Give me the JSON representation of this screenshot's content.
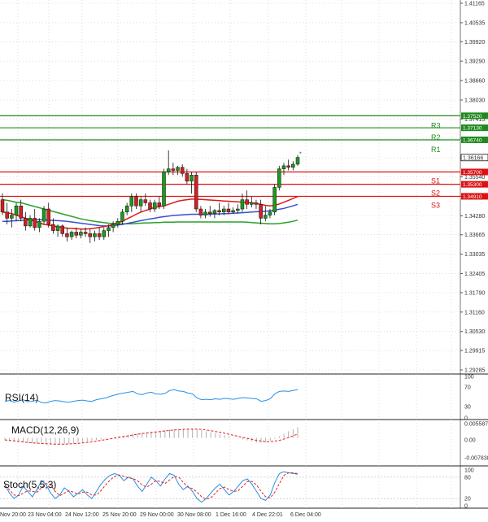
{
  "chart_data": {
    "type": "candlestick",
    "price_axis_ticks": [
      "1.41165",
      "1.40535",
      "1.39920",
      "1.39290",
      "1.38660",
      "1.38030",
      "1.37415",
      "1.36785",
      "1.36155",
      "1.35540",
      "1.34910",
      "1.34280",
      "1.33665",
      "1.33035",
      "1.32405",
      "1.31790",
      "1.31160",
      "1.30530",
      "1.29915",
      "1.29285"
    ],
    "time_axis_labels": [
      "Nov 20:00",
      "23 Nov 04:00",
      "24 Nov 12:00",
      "25 Nov 20:00",
      "29 Nov 00:00",
      "30 Nov 08:00",
      "1 Dec 16:00",
      "4 Dec 22:01",
      "6 Dec 04:00"
    ],
    "current_price": "1.36166",
    "levels": [
      {
        "name": "R3",
        "value": "1.37520",
        "color": "#1e8a1e"
      },
      {
        "name": "R2",
        "value": "1.37130",
        "color": "#1e8a1e"
      },
      {
        "name": "R1",
        "value": "1.36740",
        "color": "#1e8a1e"
      },
      {
        "name": "S1",
        "value": "1.35700",
        "color": "#dd1111"
      },
      {
        "name": "S2",
        "value": "1.35300",
        "color": "#dd1111"
      },
      {
        "name": "S3",
        "value": "1.34910",
        "color": "#dd1111"
      }
    ],
    "candles": [
      [
        1.348,
        1.35,
        1.343,
        1.344
      ],
      [
        1.344,
        1.347,
        1.34,
        1.342
      ],
      [
        1.342,
        1.345,
        1.339,
        1.343
      ],
      [
        1.343,
        1.347,
        1.341,
        1.346
      ],
      [
        1.346,
        1.348,
        1.341,
        1.342
      ],
      [
        1.342,
        1.344,
        1.338,
        1.3395
      ],
      [
        1.3395,
        1.343,
        1.339,
        1.342
      ],
      [
        1.342,
        1.345,
        1.338,
        1.339
      ],
      [
        1.339,
        1.342,
        1.3375,
        1.341
      ],
      [
        1.341,
        1.346,
        1.34,
        1.345
      ],
      [
        1.345,
        1.347,
        1.339,
        1.34
      ],
      [
        1.34,
        1.342,
        1.337,
        1.338
      ],
      [
        1.338,
        1.34,
        1.336,
        1.3395
      ],
      [
        1.3395,
        1.34,
        1.336,
        1.337
      ],
      [
        1.337,
        1.339,
        1.3345,
        1.336
      ],
      [
        1.336,
        1.338,
        1.335,
        1.3375
      ],
      [
        1.3375,
        1.339,
        1.3355,
        1.3365
      ],
      [
        1.3365,
        1.3385,
        1.3355,
        1.3375
      ],
      [
        1.3375,
        1.339,
        1.336,
        1.337
      ],
      [
        1.337,
        1.3385,
        1.334,
        1.336
      ],
      [
        1.336,
        1.338,
        1.3345,
        1.337
      ],
      [
        1.337,
        1.339,
        1.335,
        1.336
      ],
      [
        1.336,
        1.339,
        1.335,
        1.338
      ],
      [
        1.338,
        1.34,
        1.336,
        1.339
      ],
      [
        1.339,
        1.341,
        1.3375,
        1.34
      ],
      [
        1.34,
        1.342,
        1.339,
        1.341
      ],
      [
        1.341,
        1.345,
        1.34,
        1.344
      ],
      [
        1.344,
        1.347,
        1.343,
        1.346
      ],
      [
        1.346,
        1.35,
        1.344,
        1.349
      ],
      [
        1.349,
        1.35,
        1.345,
        1.346
      ],
      [
        1.346,
        1.349,
        1.344,
        1.348
      ],
      [
        1.348,
        1.35,
        1.346,
        1.347
      ],
      [
        1.347,
        1.348,
        1.344,
        1.345
      ],
      [
        1.345,
        1.348,
        1.344,
        1.347
      ],
      [
        1.347,
        1.349,
        1.345,
        1.346
      ],
      [
        1.346,
        1.358,
        1.345,
        1.357
      ],
      [
        1.357,
        1.364,
        1.356,
        1.358
      ],
      [
        1.358,
        1.36,
        1.356,
        1.3575
      ],
      [
        1.3575,
        1.359,
        1.356,
        1.3585
      ],
      [
        1.3585,
        1.3595,
        1.3555,
        1.3565
      ],
      [
        1.3565,
        1.358,
        1.353,
        1.354
      ],
      [
        1.354,
        1.357,
        1.35,
        1.356
      ],
      [
        1.356,
        1.357,
        1.344,
        1.345
      ],
      [
        1.345,
        1.346,
        1.342,
        1.343
      ],
      [
        1.343,
        1.345,
        1.342,
        1.344
      ],
      [
        1.344,
        1.346,
        1.3425,
        1.3435
      ],
      [
        1.3435,
        1.345,
        1.342,
        1.3445
      ],
      [
        1.3445,
        1.347,
        1.343,
        1.344
      ],
      [
        1.344,
        1.346,
        1.343,
        1.345
      ],
      [
        1.345,
        1.347,
        1.3435,
        1.344
      ],
      [
        1.344,
        1.3455,
        1.3435,
        1.3445
      ],
      [
        1.3445,
        1.3465,
        1.3435,
        1.345
      ],
      [
        1.345,
        1.35,
        1.344,
        1.348
      ],
      [
        1.348,
        1.351,
        1.345,
        1.3465
      ],
      [
        1.3465,
        1.349,
        1.3455,
        1.347
      ],
      [
        1.347,
        1.348,
        1.345,
        1.3465
      ],
      [
        1.3465,
        1.348,
        1.34,
        1.342
      ],
      [
        1.342,
        1.346,
        1.341,
        1.343
      ],
      [
        1.343,
        1.345,
        1.342,
        1.344
      ],
      [
        1.344,
        1.353,
        1.343,
        1.352
      ],
      [
        1.352,
        1.359,
        1.351,
        1.358
      ],
      [
        1.358,
        1.36,
        1.356,
        1.359
      ],
      [
        1.359,
        1.361,
        1.3575,
        1.3585
      ],
      [
        1.3585,
        1.3605,
        1.3575,
        1.3595
      ],
      [
        1.3595,
        1.3625,
        1.359,
        1.3617
      ]
    ],
    "ma_red": [
      1.344,
      1.3438,
      1.3435,
      1.343,
      1.3425,
      1.342,
      1.3415,
      1.341,
      1.3405,
      1.34,
      1.3398,
      1.3395,
      1.3392,
      1.339,
      1.3388,
      1.3387,
      1.3386,
      1.3385,
      1.3385,
      1.3386,
      1.3388,
      1.339,
      1.3393,
      1.3396,
      1.34,
      1.3405,
      1.341,
      1.3418,
      1.3425,
      1.3433,
      1.344,
      1.3445,
      1.345,
      1.3455,
      1.3458,
      1.346,
      1.3465,
      1.347,
      1.3475,
      1.3478,
      1.348,
      1.3482,
      1.3482,
      1.3481,
      1.348,
      1.3479,
      1.3478,
      1.3477,
      1.3476,
      1.3475,
      1.3474,
      1.3473,
      1.3472,
      1.3471,
      1.347,
      1.3468,
      1.3465,
      1.3462,
      1.346,
      1.3462,
      1.3466,
      1.3472,
      1.3478,
      1.3484,
      1.349
    ],
    "ma_blue": [
      1.341,
      1.341,
      1.3411,
      1.3412,
      1.3413,
      1.3414,
      1.3415,
      1.3415,
      1.3415,
      1.3415,
      1.3414,
      1.3413,
      1.3412,
      1.3411,
      1.341,
      1.3408,
      1.3406,
      1.3404,
      1.3402,
      1.34,
      1.3398,
      1.3396,
      1.3395,
      1.3395,
      1.3396,
      1.3398,
      1.34,
      1.3403,
      1.3406,
      1.3409,
      1.3412,
      1.3415,
      1.3418,
      1.342,
      1.3423,
      1.3425,
      1.3427,
      1.3429,
      1.343,
      1.3431,
      1.3432,
      1.3433,
      1.3433,
      1.3433,
      1.3433,
      1.3433,
      1.3434,
      1.3434,
      1.3435,
      1.3435,
      1.3436,
      1.3437,
      1.3438,
      1.3439,
      1.344,
      1.3441,
      1.3442,
      1.3443,
      1.3444,
      1.3446,
      1.3449,
      1.3452,
      1.3456,
      1.346,
      1.3465
    ],
    "ma_green": [
      1.348,
      1.3478,
      1.3475,
      1.3472,
      1.347,
      1.3466,
      1.3462,
      1.3458,
      1.3454,
      1.345,
      1.3446,
      1.3442,
      1.3438,
      1.3434,
      1.343,
      1.3426,
      1.3422,
      1.3418,
      1.3415,
      1.3412,
      1.341,
      1.3408,
      1.3406,
      1.3404,
      1.3403,
      1.3402,
      1.3402,
      1.3402,
      1.3402,
      1.3403,
      1.3404,
      1.3405,
      1.3405,
      1.3406,
      1.3406,
      1.3407,
      1.3407,
      1.3407,
      1.3408,
      1.3408,
      1.3408,
      1.3408,
      1.3408,
      1.3408,
      1.3408,
      1.3408,
      1.3408,
      1.3408,
      1.3408,
      1.3408,
      1.3408,
      1.3408,
      1.3408,
      1.3407,
      1.3406,
      1.3405,
      1.3404,
      1.3403,
      1.3402,
      1.3402,
      1.3403,
      1.3405,
      1.3407,
      1.341,
      1.3414
    ],
    "rsi": {
      "title": "RSI(14)",
      "ticks": [
        "100",
        "70",
        "30",
        "0"
      ],
      "values": [
        40,
        42,
        38,
        41,
        44,
        39,
        40,
        43,
        37,
        36,
        40,
        42,
        41,
        39,
        38,
        40,
        42,
        43,
        41,
        40,
        44,
        46,
        48,
        52,
        55,
        58,
        60,
        62,
        64,
        58,
        56,
        60,
        62,
        58,
        57,
        59,
        66,
        68,
        65,
        64,
        60,
        58,
        48,
        44,
        45,
        44,
        46,
        45,
        47,
        46,
        45,
        47,
        49,
        48,
        47,
        46,
        40,
        42,
        46,
        58,
        64,
        65,
        64,
        66,
        68
      ]
    },
    "macd": {
      "title": "MACD(12,26,9)",
      "ticks": [
        "0.005587",
        "0.00",
        "-0.007838"
      ],
      "hist": [
        -0.001,
        -0.0012,
        -0.0014,
        -0.0016,
        -0.0018,
        -0.002,
        -0.0022,
        -0.0023,
        -0.0024,
        -0.0025,
        -0.0026,
        -0.0026,
        -0.0026,
        -0.0025,
        -0.0024,
        -0.0022,
        -0.002,
        -0.0018,
        -0.0015,
        -0.0012,
        -0.0009,
        -0.0006,
        -0.0003,
        0.0,
        0.0003,
        0.0006,
        0.0009,
        0.0012,
        0.0015,
        0.0018,
        0.002,
        0.0022,
        0.0024,
        0.0026,
        0.0028,
        0.003,
        0.0032,
        0.0034,
        0.0035,
        0.0036,
        0.0036,
        0.0036,
        0.0034,
        0.003,
        0.0026,
        0.0022,
        0.0018,
        0.0014,
        0.001,
        0.0006,
        0.0002,
        -0.0002,
        -0.0006,
        -0.001,
        -0.0014,
        -0.0018,
        -0.002,
        -0.0018,
        -0.0012,
        -0.0004,
        0.0006,
        0.0016,
        0.0026,
        0.0034,
        0.0042
      ],
      "signal": [
        -0.0008,
        -0.001,
        -0.0012,
        -0.0014,
        -0.0016,
        -0.0018,
        -0.002,
        -0.0021,
        -0.0022,
        -0.0023,
        -0.0024,
        -0.0025,
        -0.0025,
        -0.0025,
        -0.0024,
        -0.0023,
        -0.0022,
        -0.002,
        -0.0018,
        -0.0016,
        -0.0013,
        -0.001,
        -0.0007,
        -0.0004,
        -0.0001,
        0.0002,
        0.0005,
        0.0008,
        0.0011,
        0.0014,
        0.0017,
        0.0019,
        0.0021,
        0.0023,
        0.0025,
        0.0027,
        0.0029,
        0.0031,
        0.0032,
        0.0033,
        0.0034,
        0.0034,
        0.0034,
        0.0033,
        0.0031,
        0.0028,
        0.0025,
        0.0022,
        0.0018,
        0.0014,
        0.001,
        0.0006,
        0.0002,
        -0.0002,
        -0.0006,
        -0.001,
        -0.0013,
        -0.0015,
        -0.0015,
        -0.0013,
        -0.001,
        -0.0005,
        0.0001,
        0.0008,
        0.0015
      ]
    },
    "stoch": {
      "title": "Stoch(5,5,3)",
      "ticks": [
        "100",
        "80",
        "20",
        "0"
      ],
      "k": [
        60,
        35,
        20,
        30,
        55,
        40,
        25,
        45,
        70,
        60,
        35,
        20,
        30,
        50,
        40,
        25,
        35,
        45,
        30,
        20,
        40,
        60,
        75,
        85,
        90,
        85,
        70,
        80,
        75,
        55,
        40,
        60,
        80,
        70,
        55,
        75,
        90,
        85,
        60,
        45,
        55,
        40,
        20,
        10,
        20,
        35,
        50,
        60,
        45,
        30,
        40,
        55,
        70,
        75,
        60,
        40,
        20,
        15,
        30,
        65,
        90,
        95,
        92,
        90,
        88
      ],
      "d": [
        55,
        45,
        30,
        28,
        35,
        42,
        40,
        38,
        50,
        62,
        58,
        40,
        28,
        35,
        42,
        38,
        32,
        38,
        38,
        30,
        30,
        42,
        58,
        72,
        82,
        86,
        82,
        78,
        76,
        70,
        58,
        52,
        60,
        70,
        68,
        62,
        72,
        82,
        80,
        65,
        52,
        48,
        38,
        25,
        18,
        22,
        35,
        48,
        52,
        45,
        40,
        42,
        55,
        68,
        68,
        58,
        40,
        25,
        22,
        38,
        62,
        85,
        92,
        92,
        90
      ]
    }
  }
}
